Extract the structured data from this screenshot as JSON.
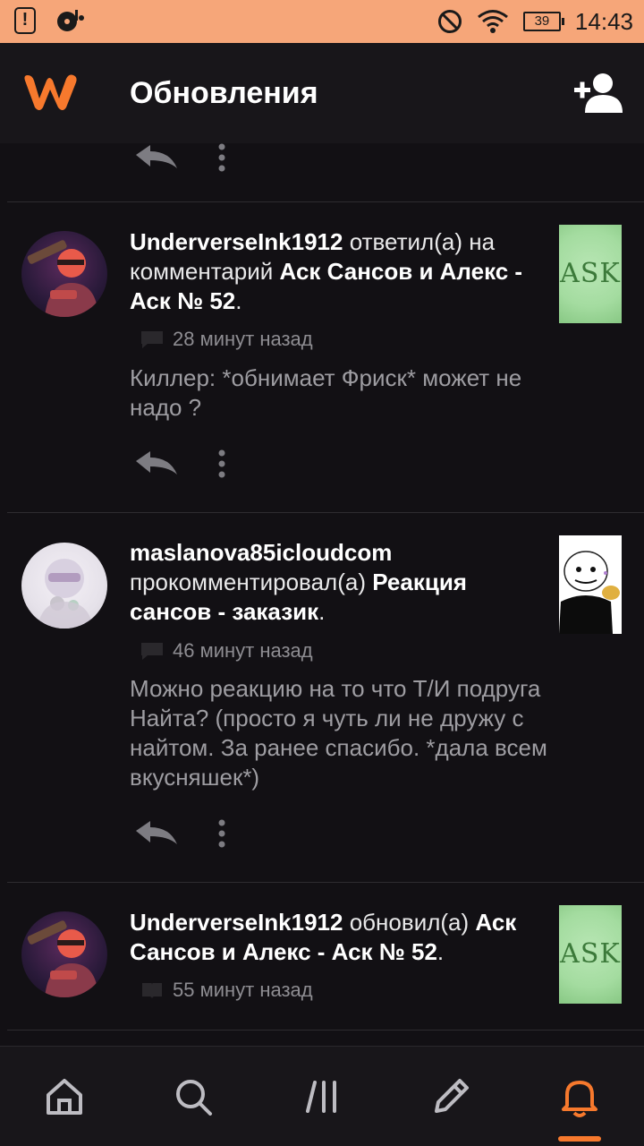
{
  "status_bar": {
    "time": "14:43",
    "battery": "39",
    "icons": [
      "alert-icon",
      "music-icon",
      "dnd-icon",
      "wifi-icon",
      "battery-icon"
    ]
  },
  "app_bar": {
    "title": "Обновления",
    "logo": "wattpad-logo",
    "action_icon": "add-user-icon",
    "brand_color": "#f7792d"
  },
  "notifications": [
    {
      "actor": "UnderverseInk1912",
      "action": " ответил(а) на комментарий ",
      "target": "Аск Сансов и Алекс - Аск № 52",
      "time": "28 минут назад",
      "comment": "Киллер: *обнимает Фриск* может не надо ?",
      "thumb_text": "ASK",
      "meta_icon": "comment-icon"
    },
    {
      "actor": "maslanova85icloudcom",
      "action": " прокомментировал(а) ",
      "target": "Реакция сансов - заказик",
      "time": "46 минут назад",
      "comment": "Можно реакцию на то что Т/И подруга Найта? (просто я чуть ли не дружу с найтом. За ранее спасибо. *дала всем вкусняшек*)",
      "meta_icon": "comment-icon"
    },
    {
      "actor": "UnderverseInk1912",
      "action": " обновил(а) ",
      "target": "Аск Сансов и Алекс - Аск № 52",
      "time": "55 минут назад",
      "thumb_text": "ASK",
      "meta_icon": "book-icon"
    }
  ],
  "bottom_nav": {
    "items": [
      "home-icon",
      "search-icon",
      "library-icon",
      "write-icon",
      "notifications-icon"
    ],
    "active": "notifications-icon"
  }
}
